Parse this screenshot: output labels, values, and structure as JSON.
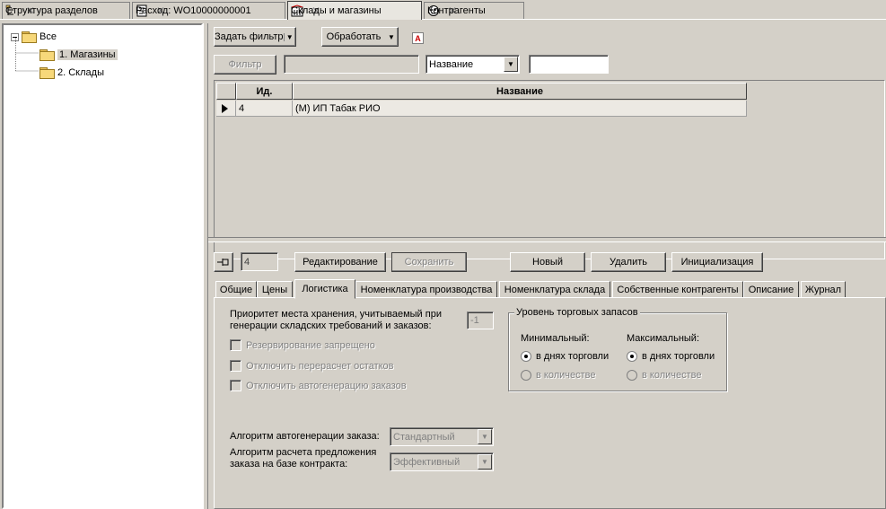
{
  "tabs": [
    {
      "label": "Структура разделов",
      "icon": "structure-icon",
      "active": false
    },
    {
      "label": "Расход: WO10000000001",
      "icon": "document-icon",
      "active": false
    },
    {
      "label": "Склады и магазины",
      "icon": "warehouse-icon",
      "active": true
    },
    {
      "label": "Контрагенты",
      "icon": "contractors-icon",
      "active": false
    }
  ],
  "tree": {
    "root": "Все",
    "items": [
      "1. Магазины",
      "2. Склады"
    ]
  },
  "toolbar": {
    "set_filter": "Задать фильтр",
    "process": "Обработать",
    "filter_button": "Фильтр",
    "filter_value": "",
    "field_select": "Название",
    "search_value": ""
  },
  "grid": {
    "columns": [
      "Ид.",
      "Название"
    ],
    "rows": [
      {
        "id": "4",
        "name": "(М) ИП Табак РИО"
      }
    ]
  },
  "detail": {
    "id_value": "4",
    "edit": "Редактирование",
    "save": "Сохранить",
    "new": "Новый",
    "delete": "Удалить",
    "init": "Инициализация"
  },
  "detail_tabs": [
    "Общие",
    "Цены",
    "Логистика",
    "Номенклатура производства",
    "Номенклатура склада",
    "Собственные контрагенты",
    "Описание",
    "Журнал"
  ],
  "logistics": {
    "priority_label_1": "Приоритет места хранения, учитываемый при",
    "priority_label_2": "генерации складских требований и заказов:",
    "priority_value": "-1",
    "reserve_forbidden": "Резервирование запрещено",
    "disable_recalc": "Отключить перерасчет остатков",
    "disable_autogen": "Отключить автогенерацию заказов",
    "stock_group_title": "Уровень торговых запасов",
    "min_label": "Минимальный:",
    "max_label": "Максимальный:",
    "in_days": "в днях торговли",
    "in_qty": "в количестве",
    "autogen_label": "Алгоритм автогенерации заказа:",
    "autogen_value": "Стандартный",
    "calc_label_1": "Алгоритм расчета предложения",
    "calc_label_2": "заказа на базе контракта:",
    "calc_value": "Эффективный"
  },
  "colors": {
    "accent_red": "#cc0000",
    "window_bg": "#d4d0c8"
  }
}
